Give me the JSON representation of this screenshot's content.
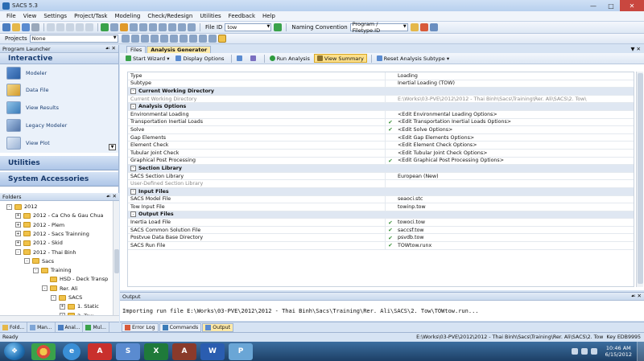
{
  "window": {
    "title": "SACS 5.3"
  },
  "menu": [
    "File",
    "View",
    "Settings",
    "Project/Task",
    "Modeling",
    "Check/Redesign",
    "Utilities",
    "Feedback",
    "Help"
  ],
  "toolbar": {
    "file_id_label": "File ID",
    "file_id_value": "tow",
    "naming_label": "Naming Convention",
    "naming_value": "Program / Filetype.ID"
  },
  "projects": {
    "label": "Projects",
    "value": "None"
  },
  "launcher": {
    "title": "Program Launcher",
    "section": "Interactive",
    "items": [
      "Modeler",
      "Data File",
      "View Results",
      "Legacy Modeler",
      "View Plot"
    ],
    "utilities": "Utilities",
    "accessories": "System Accessories"
  },
  "folders": {
    "title": "Folders",
    "items": [
      {
        "label": "2012",
        "level": 0,
        "exp": "-"
      },
      {
        "label": "2012 - Ca Cho & Gau Chua",
        "level": 1,
        "exp": "+"
      },
      {
        "label": "2012 - Plem",
        "level": 1,
        "exp": "+"
      },
      {
        "label": "2012 - Sacs Trainning",
        "level": 1,
        "exp": "+"
      },
      {
        "label": "2012 - Skid",
        "level": 1,
        "exp": "+"
      },
      {
        "label": "2012 - Thai Binh",
        "level": 1,
        "exp": "-"
      },
      {
        "label": "Sacs",
        "level": 2,
        "exp": "-"
      },
      {
        "label": "Training",
        "level": 3,
        "exp": "-"
      },
      {
        "label": "HSD - Deck Transp",
        "level": 4,
        "exp": ""
      },
      {
        "label": "Rer. Ali",
        "level": 4,
        "exp": "-"
      },
      {
        "label": "SACS",
        "level": 5,
        "exp": "-"
      },
      {
        "label": "1. Static",
        "level": 6,
        "exp": "+"
      },
      {
        "label": "2. Tow",
        "level": 6,
        "exp": "+"
      }
    ]
  },
  "left_tabs": [
    "Fold...",
    "Man...",
    "Anal...",
    "Mul..."
  ],
  "doc_tabs": [
    "Files",
    "Analysis Generator"
  ],
  "actions": {
    "start_wizard": "Start Wizard",
    "display_options": "Display Options",
    "run_analysis": "Run Analysis",
    "view_summary": "View Summary",
    "reset_subtype": "Reset Analysis Subtype"
  },
  "grid": [
    {
      "type": "row",
      "name": "Type",
      "check": false,
      "value": "Loading"
    },
    {
      "type": "row",
      "name": "Subtype",
      "check": false,
      "value": "Inertial Loading (TOW)"
    },
    {
      "type": "cat",
      "name": "Current Working Directory"
    },
    {
      "type": "dis",
      "name": "Current Working Directory",
      "check": false,
      "value": "E:\\Works\\03-PVE\\2012\\2012 - Thai Binh\\Sacs\\Training\\Rer. Ali\\SACS\\2. Tow\\"
    },
    {
      "type": "cat",
      "name": "Analysis Options"
    },
    {
      "type": "row",
      "name": "Environmental Loading",
      "check": false,
      "value": "<Edit Environmental Loading Options>"
    },
    {
      "type": "row",
      "name": "Transportation Inertial Loads",
      "check": true,
      "value": "<Edit Transportation Inertial Loads Options>"
    },
    {
      "type": "row",
      "name": "Solve",
      "check": true,
      "value": "<Edit Solve Options>"
    },
    {
      "type": "row",
      "name": "Gap Elements",
      "check": false,
      "value": "<Edit Gap Elements Options>"
    },
    {
      "type": "row",
      "name": "Element Check",
      "check": false,
      "value": "<Edit Element Check Options>"
    },
    {
      "type": "row",
      "name": "Tubular Joint Check",
      "check": false,
      "value": "<Edit Tubular Joint Check Options>"
    },
    {
      "type": "row",
      "name": "Graphical Post Processing",
      "check": true,
      "value": "<Edit Graphical Post Processing Options>"
    },
    {
      "type": "cat",
      "name": "Section Library"
    },
    {
      "type": "row",
      "name": "SACS Section Library",
      "check": false,
      "value": "European (New)"
    },
    {
      "type": "dis",
      "name": "User-Defined Section Library",
      "check": false,
      "value": ""
    },
    {
      "type": "cat",
      "name": "Input Files"
    },
    {
      "type": "row",
      "name": "SACS Model File",
      "check": false,
      "value": "seaoci.stc"
    },
    {
      "type": "row",
      "name": "Tow Input File",
      "check": false,
      "value": "towinp.tow"
    },
    {
      "type": "cat",
      "name": "Output Files"
    },
    {
      "type": "row",
      "name": "Inertia Load File",
      "check": true,
      "value": "towoci.tow"
    },
    {
      "type": "row",
      "name": "SACS Common Solution File",
      "check": true,
      "value": "saccsf.tow"
    },
    {
      "type": "row",
      "name": "Postvue Data Base Directory",
      "check": true,
      "value": "psvdb.tow"
    },
    {
      "type": "row",
      "name": "SACS Run File",
      "check": true,
      "value": "TOWtow.runx"
    }
  ],
  "output": {
    "title": "Output",
    "text": "Importing run file E:\\Works\\03-PVE\\2012\\2012 - Thai Binh\\Sacs\\Training\\Rer. Ali\\SACS\\2. Tow\\TOWtow.run..."
  },
  "output_tabs": [
    "Error Log",
    "Commands",
    "Output"
  ],
  "status": {
    "ready": "Ready",
    "path": "E:\\Works\\03-PVE\\2012\\2012 - Thai Binh\\Sacs\\Training\\Rer. Ali\\SACS\\2. Tow",
    "key": "Key EDB9995"
  },
  "clock": {
    "time": "10:46 AM",
    "date": "6/15/2012"
  },
  "taskbar_apps": [
    "chrome",
    "ie",
    "acrobat",
    "sacs",
    "excel",
    "access",
    "word",
    "paint"
  ]
}
